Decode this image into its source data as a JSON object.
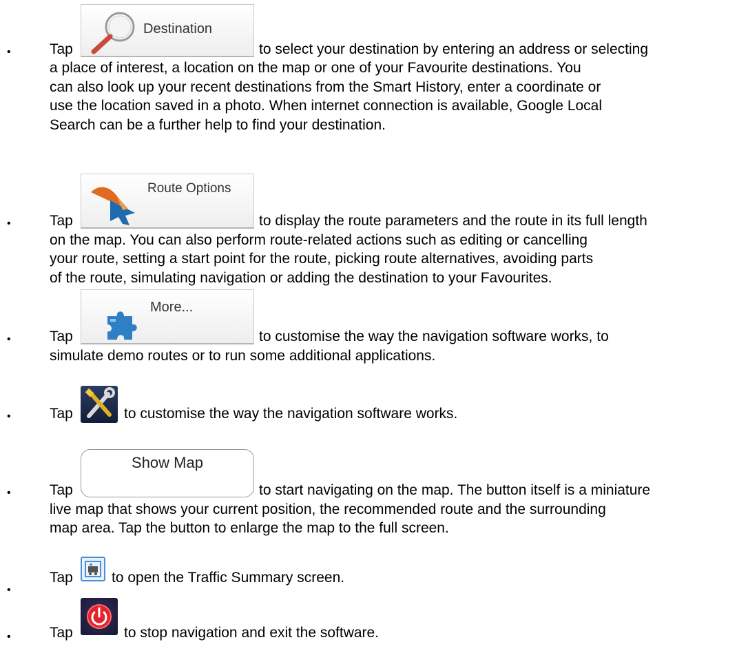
{
  "bullet_char": "•",
  "items": [
    {
      "tap": "Tap",
      "button_label": "Destination",
      "button_icon": "magnifier-icon",
      "first_line_rest": "to select your destination by entering an address or selecting",
      "lines": [
        "a place of interest, a location on the map or one of your Favourite destinations. You",
        "can also look up your recent destinations from the Smart History, enter a coordinate or",
        "use the location saved in a photo. When internet connection is available, Google Local",
        "Search can be a further help to find your destination."
      ]
    },
    {
      "tap": "Tap",
      "button_label": "Route Options",
      "button_icon": "route-arrow-icon",
      "first_line_rest": "to display the route parameters and the route in its full length",
      "lines": [
        "on the map. You can also perform route-related actions such as editing or cancelling",
        "your route, setting a start point for the route, picking route alternatives, avoiding parts",
        "of the route, simulating navigation or adding the destination to your Favourites."
      ]
    },
    {
      "tap": "Tap",
      "button_label": "More...",
      "button_icon": "puzzle-piece-icon",
      "first_line_rest": "to customise the way the navigation software works, to",
      "lines": [
        "simulate demo routes or to run some additional applications."
      ]
    },
    {
      "tap": "Tap",
      "button_icon": "tools-icon",
      "first_line_rest": "to customise the way the navigation software works.",
      "lines": []
    },
    {
      "tap": "Tap",
      "button_label": "Show Map",
      "first_line_rest": "to start navigating on the map. The button itself is a miniature",
      "lines": [
        "live map that shows your current position, the recommended route and the surrounding",
        "map area. Tap the button to enlarge the map to the full screen."
      ]
    },
    {
      "tap": "Tap",
      "button_icon": "traffic-icon",
      "first_line_rest": "to open the Traffic Summary screen.",
      "lines": []
    },
    {
      "tap": "Tap",
      "button_icon": "power-icon",
      "first_line_rest": "to stop navigation and exit the software.",
      "lines": []
    }
  ],
  "colors": {
    "text": "#000000",
    "button_border": "#c9c9c9",
    "dark_icon_bg": "#1c2a4a",
    "power_red": "#d4202a"
  }
}
